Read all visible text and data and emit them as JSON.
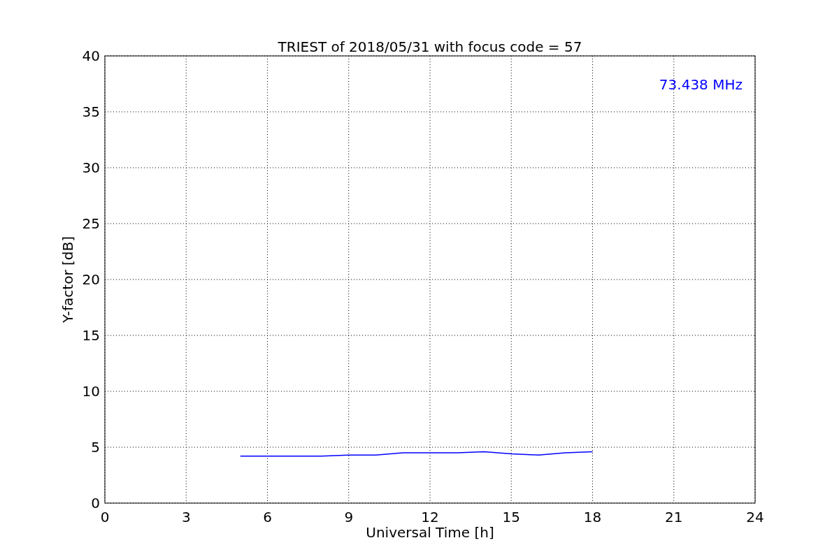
{
  "figure": {
    "chart_data": {
      "type": "line",
      "title": "TRIEST of 2018/05/31 with focus code = 57",
      "xlabel": "Universal Time [h]",
      "ylabel": "Y-factor [dB]",
      "x": [
        5,
        6,
        7,
        8,
        9,
        10,
        11,
        12,
        13,
        14,
        15,
        16,
        17,
        18
      ],
      "series": [
        {
          "name": "73.438 MHz",
          "color": "#0000ff",
          "values": [
            4.2,
            4.2,
            4.2,
            4.2,
            4.3,
            4.3,
            4.5,
            4.5,
            4.5,
            4.6,
            4.4,
            4.3,
            4.5,
            4.6
          ]
        }
      ],
      "xlim": [
        0,
        24
      ],
      "ylim": [
        0,
        40
      ],
      "xticks": [
        0,
        3,
        6,
        9,
        12,
        15,
        18,
        21,
        24
      ],
      "yticks": [
        0,
        5,
        10,
        15,
        20,
        25,
        30,
        35,
        40
      ],
      "grid": true
    }
  }
}
